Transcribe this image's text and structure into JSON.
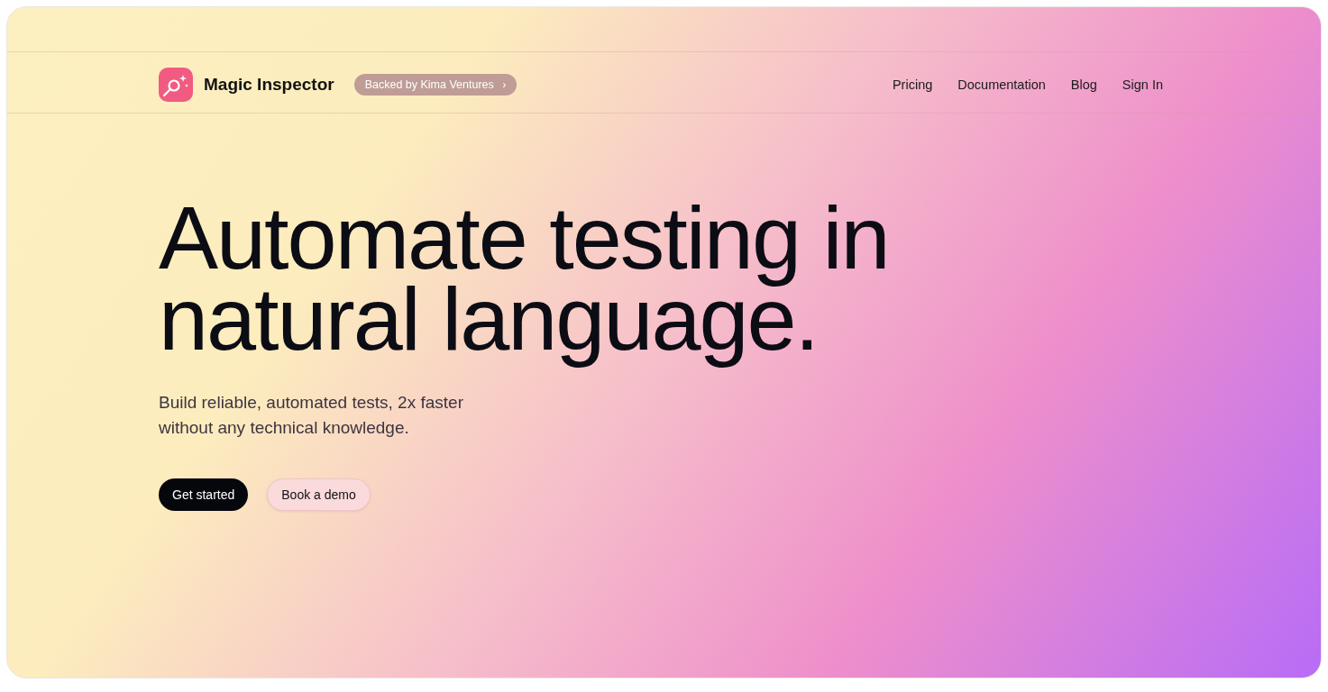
{
  "brand": {
    "name": "Magic Inspector"
  },
  "badge": {
    "label": "Backed by Kima Ventures",
    "chevron": "›"
  },
  "nav": [
    {
      "label": "Pricing"
    },
    {
      "label": "Documentation"
    },
    {
      "label": "Blog"
    },
    {
      "label": "Sign In"
    }
  ],
  "hero": {
    "title_lines": [
      "Automate testing in",
      "natural language."
    ],
    "subtitle_lines": [
      "Build reliable, automated tests, 2x faster",
      "without any technical knowledge."
    ]
  },
  "buttons": [
    {
      "label": "Get started",
      "kind": "primary"
    },
    {
      "label": "Book a demo",
      "kind": "secondary"
    }
  ]
}
